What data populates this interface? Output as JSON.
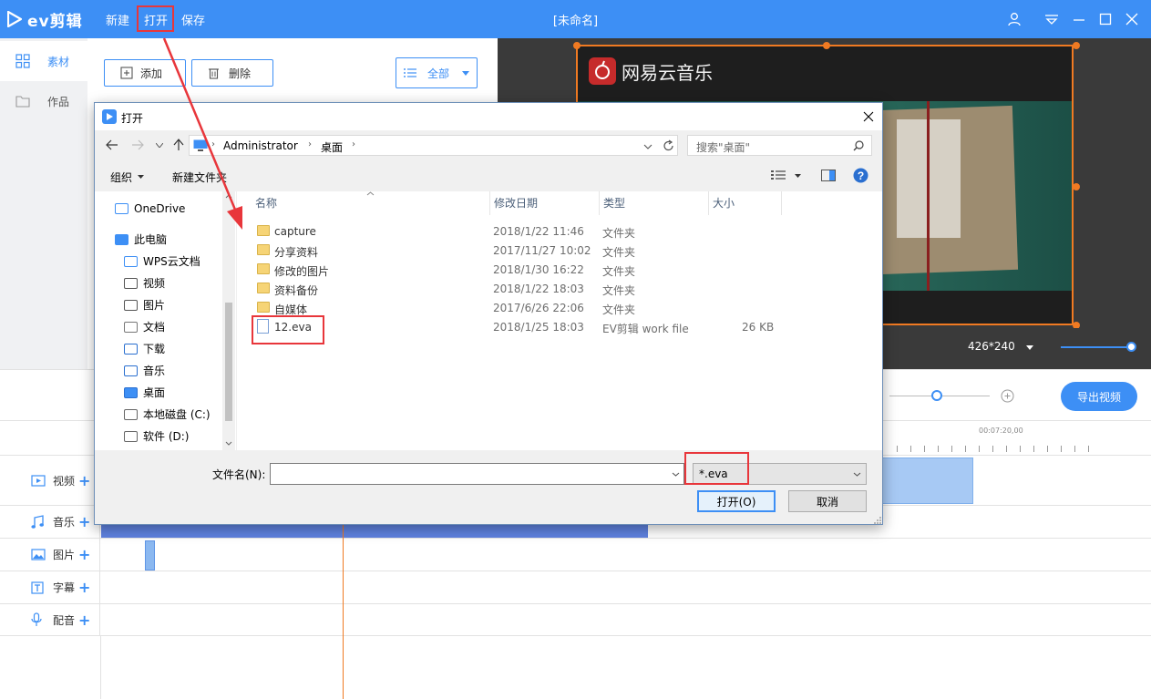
{
  "app": {
    "logo_text": "ev剪辑",
    "menu": {
      "new": "新建",
      "open": "打开",
      "save": "保存"
    },
    "title": "[未命名]"
  },
  "sidebar": {
    "items": [
      {
        "label": "素材",
        "icon": "grid-icon"
      },
      {
        "label": "作品",
        "icon": "folder-icon"
      }
    ]
  },
  "material": {
    "add_label": "添加",
    "delete_label": "删除",
    "filter_label": "全部"
  },
  "preview": {
    "watermark": "网易云音乐",
    "resolution": "426*240"
  },
  "timeline": {
    "export_label": "导出视频",
    "ruler_time": "00:07:20,00",
    "tracks": [
      {
        "label": "视频",
        "icon": "video-icon"
      },
      {
        "label": "音乐",
        "icon": "music-icon"
      },
      {
        "label": "图片",
        "icon": "image-icon"
      },
      {
        "label": "字幕",
        "icon": "subtitle-icon"
      },
      {
        "label": "配音",
        "icon": "microphone-icon"
      }
    ]
  },
  "dialog": {
    "title": "打开",
    "breadcrumb": [
      "Administrator",
      "桌面"
    ],
    "search_placeholder": "搜索\"桌面\"",
    "organize_label": "组织",
    "new_folder_label": "新建文件夹",
    "nav": [
      {
        "label": "OneDrive",
        "icon": "cloud-icon"
      },
      {
        "label": "此电脑",
        "icon": "computer-icon"
      },
      {
        "label": "WPS云文档",
        "icon": "cloud-icon"
      },
      {
        "label": "视频",
        "icon": "video-folder-icon"
      },
      {
        "label": "图片",
        "icon": "picture-folder-icon"
      },
      {
        "label": "文档",
        "icon": "document-icon"
      },
      {
        "label": "下载",
        "icon": "download-icon"
      },
      {
        "label": "音乐",
        "icon": "music-note-icon"
      },
      {
        "label": "桌面",
        "icon": "desktop-icon"
      },
      {
        "label": "本地磁盘 (C:)",
        "icon": "drive-icon"
      },
      {
        "label": "软件 (D:)",
        "icon": "drive-icon"
      }
    ],
    "columns": {
      "name": "名称",
      "modified": "修改日期",
      "type": "类型",
      "size": "大小"
    },
    "files": [
      {
        "name": "capture",
        "modified": "2018/1/22 11:46",
        "type": "文件夹",
        "size": ""
      },
      {
        "name": "分享资料",
        "modified": "2017/11/27 10:02",
        "type": "文件夹",
        "size": ""
      },
      {
        "name": "修改的图片",
        "modified": "2018/1/30 16:22",
        "type": "文件夹",
        "size": ""
      },
      {
        "name": "资料备份",
        "modified": "2018/1/22 18:03",
        "type": "文件夹",
        "size": ""
      },
      {
        "name": "自媒体",
        "modified": "2017/6/26 22:06",
        "type": "文件夹",
        "size": ""
      },
      {
        "name": "12.eva",
        "modified": "2018/1/25 18:03",
        "type": "EV剪辑 work file",
        "size": "26 KB"
      }
    ],
    "filename_label": "文件名(N):",
    "filename_value": "",
    "filter_value": "*.eva",
    "open_label": "打开(O)",
    "cancel_label": "取消"
  },
  "colors": {
    "accent": "#3d8ff5",
    "highlight": "#e8363b",
    "preview_border": "#f07a22"
  }
}
